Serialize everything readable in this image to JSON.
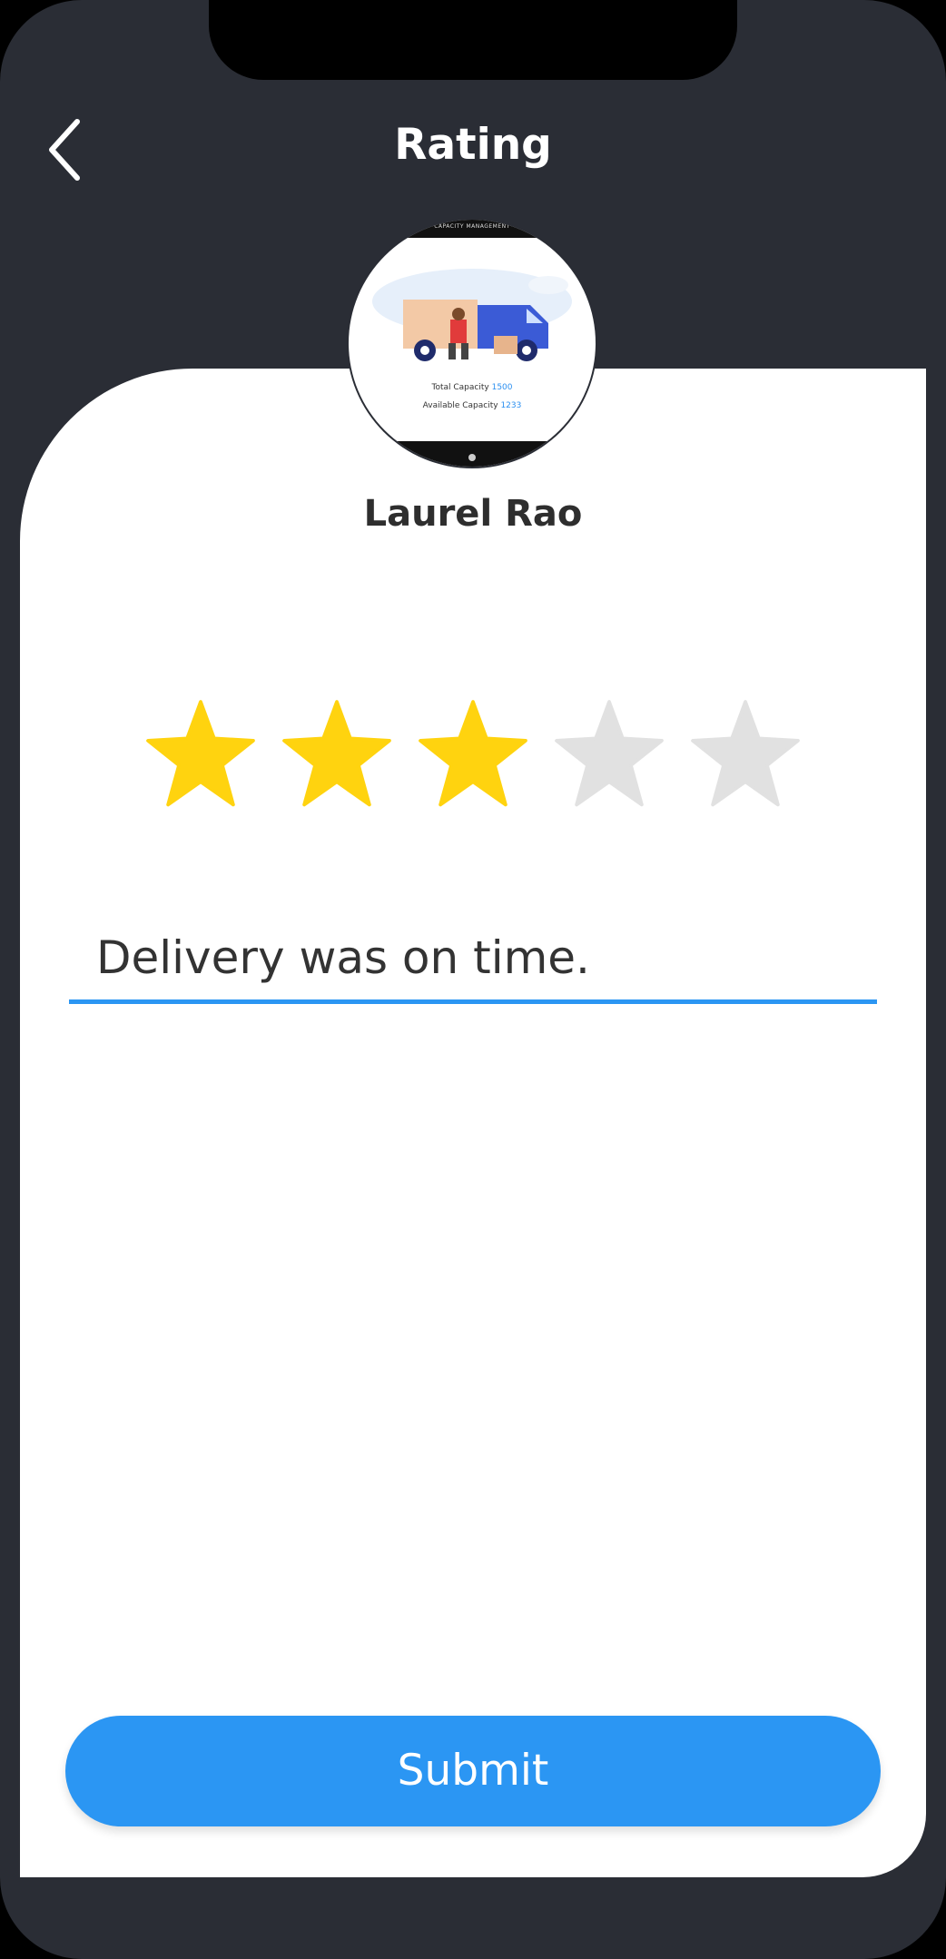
{
  "header": {
    "title": "Rating",
    "back_icon": "chevron-left-icon"
  },
  "profile": {
    "name": "Laurel Rao",
    "avatar": {
      "header_text": "CAPACITY MANAGEMENT",
      "total_label": "Total Capacity",
      "total_value": "1500",
      "available_label": "Available Capacity",
      "available_value": "1233"
    }
  },
  "rating": {
    "value": 3,
    "max": 5,
    "filled_color": "#FFD30F",
    "empty_color": "#E1E1E1",
    "icon": "star-icon"
  },
  "comment": {
    "value": "Delivery was on time."
  },
  "submit": {
    "label": "Submit",
    "color": "#2B96F3"
  },
  "colors": {
    "background": "#2A2D35",
    "card": "#FFFFFF",
    "accent": "#2B96F3"
  }
}
